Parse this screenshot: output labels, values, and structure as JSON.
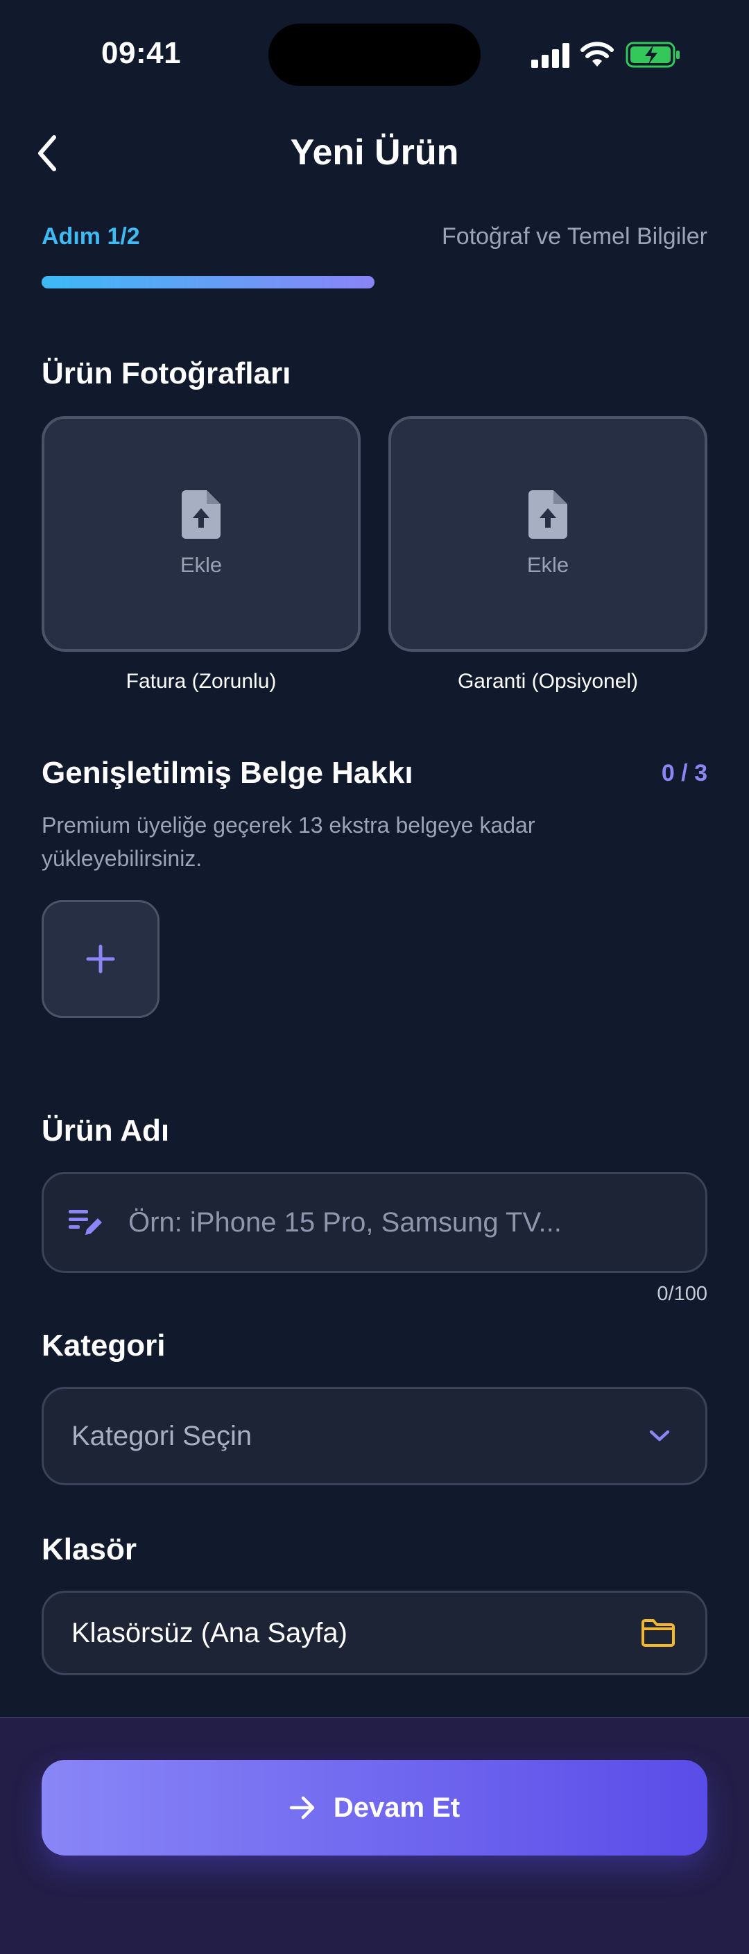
{
  "status_bar": {
    "time": "09:41"
  },
  "header": {
    "title": "Yeni Ürün",
    "back_icon": "chevron-left-icon"
  },
  "step": {
    "label": "Adım 1/2",
    "description": "Fotoğraf ve Temel Bilgiler",
    "progress": 0.5
  },
  "photos": {
    "title": "Ürün Fotoğrafları",
    "slots": [
      {
        "action_label": "Ekle",
        "caption": "Fatura (Zorunlu)"
      },
      {
        "action_label": "Ekle",
        "caption": "Garanti (Opsiyonel)"
      }
    ]
  },
  "extended_docs": {
    "title": "Genişletilmiş Belge Hakkı",
    "counter": "0 / 3",
    "description": "Premium üyeliğe geçerek 13 ekstra belgeye kadar yükleyebilirsiniz."
  },
  "product_name": {
    "label": "Ürün Adı",
    "placeholder": "Örn: iPhone 15 Pro, Samsung TV...",
    "char_count": "0/100"
  },
  "category": {
    "label": "Kategori",
    "placeholder": "Kategori Seçin"
  },
  "folder": {
    "label": "Klasör",
    "value": "Klasörsüz (Ana Sayfa)"
  },
  "continue_button": {
    "label": "Devam Et"
  },
  "colors": {
    "background": "#111a2c",
    "accent_blue": "#3ebbf5",
    "accent_purple": "#8b86f6",
    "folder_yellow": "#f5b82a",
    "battery_green": "#34c759"
  }
}
